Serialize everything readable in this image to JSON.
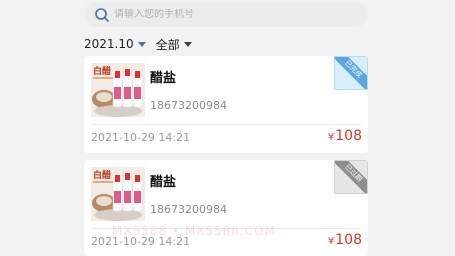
{
  "search": {
    "placeholder": "请输入您的手机号"
  },
  "filters": {
    "date": "2021.10",
    "status": "全部"
  },
  "orders": [
    {
      "name": "醋盐",
      "phone": "18673200984",
      "time": "2021-10-29 14:21",
      "currency": "¥",
      "price": "108",
      "badge": "已完成",
      "badge_color": "#5aa5e0"
    },
    {
      "name": "醋盐",
      "phone": "18673200984",
      "time": "2021-10-29 14:21",
      "currency": "¥",
      "price": "108",
      "badge": "已过期",
      "badge_color": "#8e8e8e"
    }
  ],
  "product_image": {
    "brand_text": "白醋",
    "icon": "vinegar-bottles-image"
  },
  "watermark": "MX5588 • MX5588.COM",
  "colors": {
    "price": "#e0342a",
    "accent": "#4a6fa5",
    "background": "#f2f2f2"
  }
}
